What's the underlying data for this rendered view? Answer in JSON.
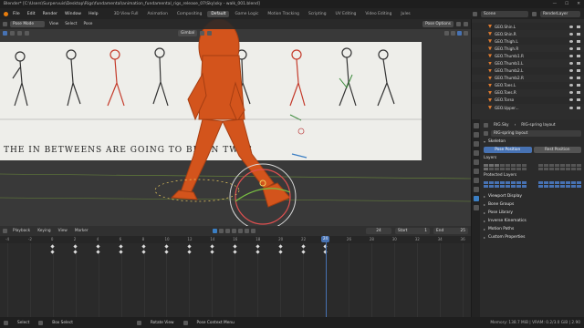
{
  "window": {
    "title": "Blender* [C:\\Users\\Surpervuis\\Desktop\\Rigs\\fundamental\\animation_fundamental_rigs_release_07\\Sky\\sky - walk_001.blend]",
    "controls": [
      "—",
      "☐",
      "✕"
    ]
  },
  "menubar": {
    "menus": [
      "File",
      "Edit",
      "Render",
      "Window",
      "Help"
    ],
    "workspaces": [
      "3D View Full",
      "Animation",
      "Compositing",
      "Default",
      "Game Logic",
      "Motion Tracking",
      "Scripting",
      "UV Editing",
      "Video Editing"
    ],
    "more": "Jules",
    "scene_label": "Scene",
    "render_layer_label": "RenderLayer"
  },
  "viewport": {
    "mode": "Pose Mode",
    "menus": [
      "View",
      "Select",
      "Pose"
    ],
    "transform_orientation": "Gimbal",
    "pose_options": "Pose Options",
    "reference_caption": "THE  IN  BETWEENS  ARE  GOING  TO  BE  ON   TWOS"
  },
  "timeline": {
    "menus": [
      "Playback",
      "Keying",
      "View",
      "Marker"
    ],
    "current_frame": "24",
    "start_label": "Start",
    "start_value": "1",
    "end_label": "End",
    "end_value": "25",
    "ruler_ticks": [
      "-4",
      "-2",
      "0",
      "2",
      "4",
      "6",
      "8",
      "10",
      "12",
      "14",
      "16",
      "18",
      "20",
      "22",
      "24",
      "26",
      "28",
      "30",
      "32",
      "34",
      "36"
    ],
    "playhead_label": "24"
  },
  "statusbar": {
    "select": "Select",
    "box_select": "Box Select",
    "rotate_view": "Rotate View",
    "context_menu": "Pose Context Menu",
    "stats": "Memory: 138.7 MiB | VRAM: 0.2/3.0 GiB | 2.90"
  },
  "outliner": {
    "items": [
      "GEO.Shin.L",
      "GEO.Shin.R",
      "GEO.Thigh.L",
      "GEO.Thigh.R",
      "GEO.Thumb1.R",
      "GEO.Thumb1.L",
      "GEO.Thumb2.L",
      "GEO.Thumb2.R",
      "GEO.Toes.L",
      "GEO.Toes.R",
      "GEO.Torso",
      "GEO.Upper..."
    ]
  },
  "properties": {
    "rig_name": "RIG.Sky",
    "layout_name": "RIG-spring layout",
    "datablock": "RIG-spring layout",
    "skeleton_panel": "Skeleton",
    "pose_position": "Pose Position",
    "rest_position": "Rest Position",
    "layers_label": "Layers",
    "protected_layers_label": "Protected Layers",
    "panels": [
      "Viewport Display",
      "Bone Groups",
      "Pose Library",
      "Inverse Kinematics",
      "Motion Paths",
      "Custom Properties"
    ]
  },
  "colors": {
    "character": "#d3541c",
    "character_dark": "#a63e12",
    "accent_blue": "#4772b3",
    "playhead": "#4772b3",
    "outliner_icon": "#e07b2e"
  }
}
